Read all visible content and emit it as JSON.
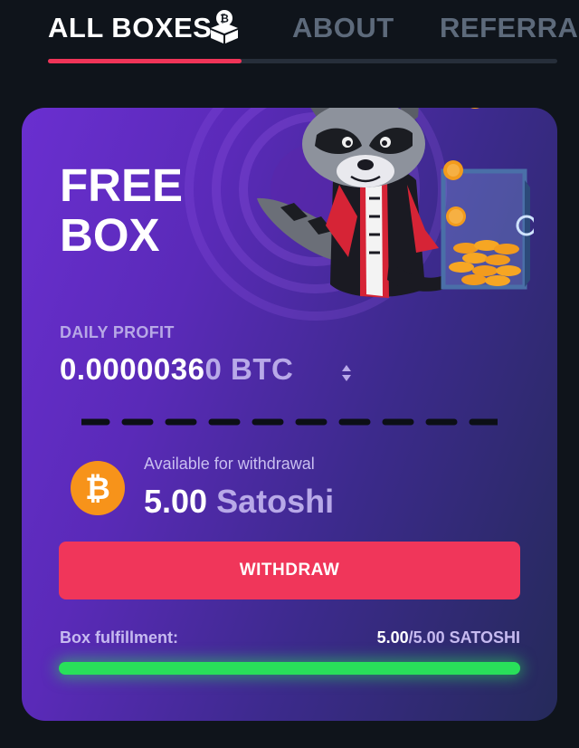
{
  "tabs": {
    "all_boxes": "ALL BOXES",
    "about": "ABOUT",
    "referral": "REFERRA"
  },
  "box": {
    "title": "FREE BOX",
    "daily_label": "DAILY PROFIT",
    "daily_value_main": "0.0000036",
    "daily_value_fade": "0",
    "daily_unit": " BTC",
    "available_label": "Available for withdrawal",
    "available_amount": "5.00",
    "available_unit": "Satoshi",
    "withdraw_label": "WITHDRAW",
    "fulfillment_label": "Box fulfillment:",
    "fulfillment_current": "5.00",
    "fulfillment_rest": "/5.00 SATOSHI",
    "fulfillment_fraction": 1.0
  },
  "colors": {
    "accent": "#f0365a",
    "progress": "#29e05a",
    "coin": "#f7931a"
  },
  "icons": {
    "tab_icon": "bitcoin-box-icon",
    "coin": "bitcoin-coin-icon",
    "mascot": "raccoon-mascot",
    "arrows": "sort-arrows-icon"
  }
}
